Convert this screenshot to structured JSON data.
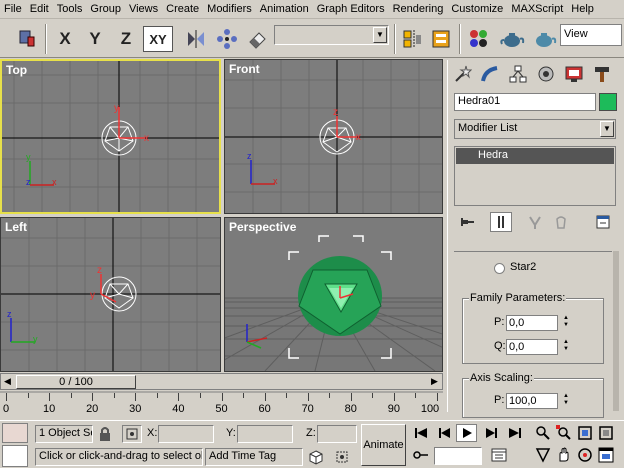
{
  "menu": [
    "File",
    "Edit",
    "Tools",
    "Group",
    "Views",
    "Create",
    "Modifiers",
    "Animation",
    "Graph Editors",
    "Rendering",
    "Customize",
    "MAXScript",
    "Help"
  ],
  "toolbar": {
    "axis_x": "X",
    "axis_y": "Y",
    "axis_z": "Z",
    "axis_xy": "XY",
    "selection_set_value": "",
    "view_value": "View"
  },
  "viewports": {
    "top": "Top",
    "front": "Front",
    "left": "Left",
    "perspective": "Perspective"
  },
  "command_panel": {
    "object_name": "Hedra01",
    "object_color": "#1dbb5a",
    "modifier_list": "Modifier List",
    "stack_items": [
      "Hedra"
    ],
    "radio_label": "Star2",
    "family_parameters": {
      "title": "Family Parameters:",
      "p_label": "P:",
      "p_value": "0,0",
      "q_label": "Q:",
      "q_value": "0,0"
    },
    "axis_scaling": {
      "title": "Axis Scaling:",
      "p_label": "P:",
      "p_value": "100,0"
    }
  },
  "time_slider": {
    "label": "0 / 100",
    "ticks": [
      "0",
      "10",
      "20",
      "30",
      "40",
      "50",
      "60",
      "70",
      "80",
      "90",
      "100"
    ]
  },
  "status": {
    "selection_info": "1 Object Se",
    "x_label": "X:",
    "y_label": "Y:",
    "z_label": "Z:",
    "prompt": "Click or click-and-drag to select ob",
    "add_time_tag": "Add Time Tag",
    "animate_label": "Animate"
  },
  "colors": {
    "active_viewport_border": "#e7e04a",
    "object_green": "#1dbb5a",
    "viewport_bg": "#7d7d7d",
    "ui_gray": "#d4d0c8"
  }
}
